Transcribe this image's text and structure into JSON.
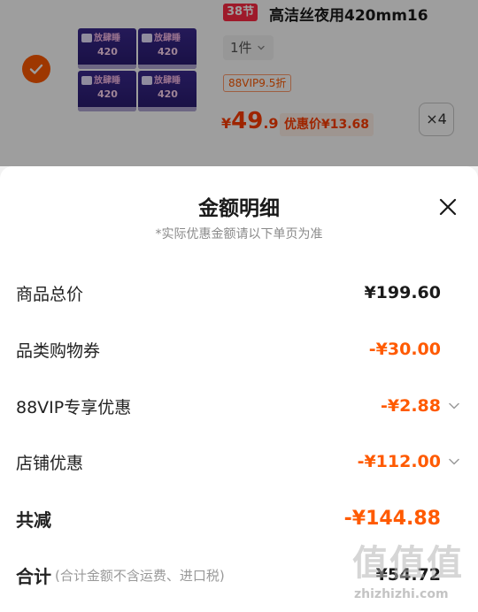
{
  "product": {
    "festival_badge": "38节",
    "title": "高洁丝夜用420mm16",
    "sku_value": "1件",
    "vip_tag": "88VIP9.5折",
    "price_currency": "¥",
    "price_integer": "49",
    "price_decimal": ".9",
    "promo_price": "优惠价¥13.68",
    "quantity": "×4",
    "pack_text": "放肆睡",
    "pack_size": "420",
    "selected": true,
    "check_color": "#ff5a00"
  },
  "sheet": {
    "title": "金额明细",
    "subtitle": "*实际优惠金额请以下单页为准",
    "close_icon": "close-icon",
    "rows": [
      {
        "label": "商品总价",
        "value": "¥199.60",
        "style": "black",
        "chevron": false
      },
      {
        "label": "品类购物券",
        "value": "-¥30.00",
        "style": "orange",
        "chevron": false
      },
      {
        "label": "88VIP专享优惠",
        "value": "-¥2.88",
        "style": "orange",
        "chevron": true
      },
      {
        "label": "店铺优惠",
        "value": "-¥112.00",
        "style": "orange",
        "chevron": true
      }
    ],
    "total_label": "共减",
    "total_value": "-¥144.88",
    "sum_label": "合计",
    "sum_note": "(合计金额不含运费、进口税)",
    "sum_value": "¥54.72"
  },
  "watermark": {
    "mark": "值值值",
    "site": "zhizhizhi.com"
  },
  "colors": {
    "accent": "#ff5a00",
    "price": "#ff3d00",
    "badge": "#ff2a44"
  }
}
